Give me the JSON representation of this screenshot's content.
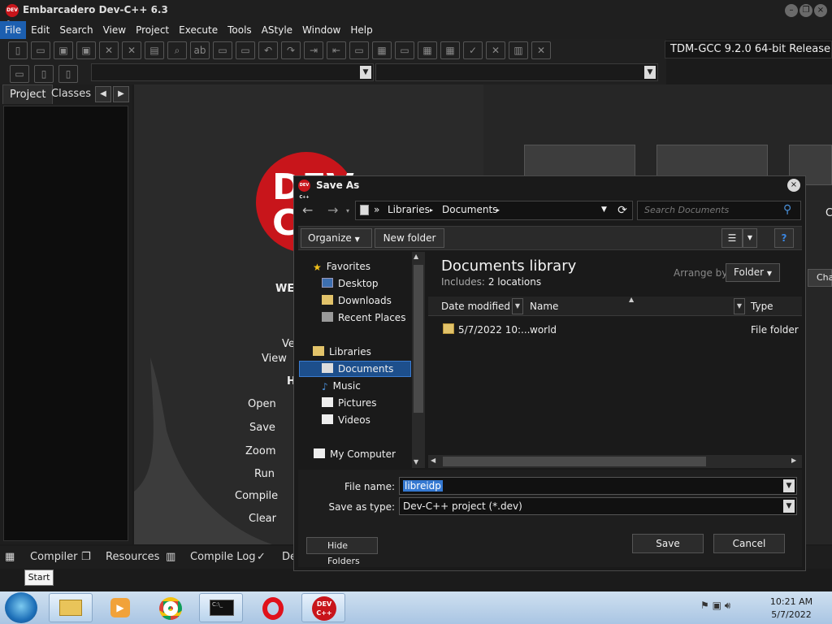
{
  "window": {
    "title": "Embarcadero Dev-C++ 6.3",
    "logo_text": "DEV C++"
  },
  "menu": [
    "File",
    "Edit",
    "Search",
    "View",
    "Project",
    "Execute",
    "Tools",
    "AStyle",
    "Window",
    "Help"
  ],
  "toolbar": {
    "compiler": "TDM-GCC 9.2.0 64-bit Release"
  },
  "left_panel": {
    "tabs": [
      "Project",
      "Classes"
    ]
  },
  "welcome": {
    "logo": "DEV C++",
    "heading": "WE",
    "lines": [
      "Ve",
      "View",
      "H"
    ],
    "shortcuts": [
      "Open",
      "Save",
      "Zoom",
      "Run",
      "Compile",
      "Clear"
    ],
    "side_fragment_1": "C",
    "side_fragment_2": "Cha"
  },
  "bottom_tabs": [
    "Compiler",
    "Resources",
    "Compile Log",
    "De"
  ],
  "start_tooltip": "Start",
  "taskbar": {
    "time": "10:21 AM",
    "date": "5/7/2022",
    "dev_label": "DEV C++"
  },
  "dialog": {
    "title": "Save As",
    "breadcrumb": [
      "Libraries",
      "Documents"
    ],
    "breadcrumb_prefix": "»",
    "search_placeholder": "Search Documents",
    "organize": "Organize",
    "new_folder": "New folder",
    "nav": {
      "favorites": "Favorites",
      "favorites_items": [
        "Desktop",
        "Downloads",
        "Recent Places"
      ],
      "libraries": "Libraries",
      "libraries_items": [
        "Documents",
        "Music",
        "Pictures",
        "Videos"
      ],
      "computer": "My Computer"
    },
    "library_title": "Documents library",
    "includes_label": "Includes:",
    "includes_value": "2 locations",
    "arrange_label": "Arrange by:",
    "arrange_value": "Folder",
    "columns": [
      "Date modified",
      "Name",
      "Type"
    ],
    "files": [
      {
        "date": "5/7/2022 10:...",
        "name": "world",
        "type": "File folder"
      }
    ],
    "file_name_label": "File name:",
    "file_name": "libreidp",
    "save_type_label": "Save as type:",
    "save_type": "Dev-C++ project (*.dev)",
    "hide_folders": "Hide Folders",
    "save": "Save",
    "cancel": "Cancel"
  }
}
